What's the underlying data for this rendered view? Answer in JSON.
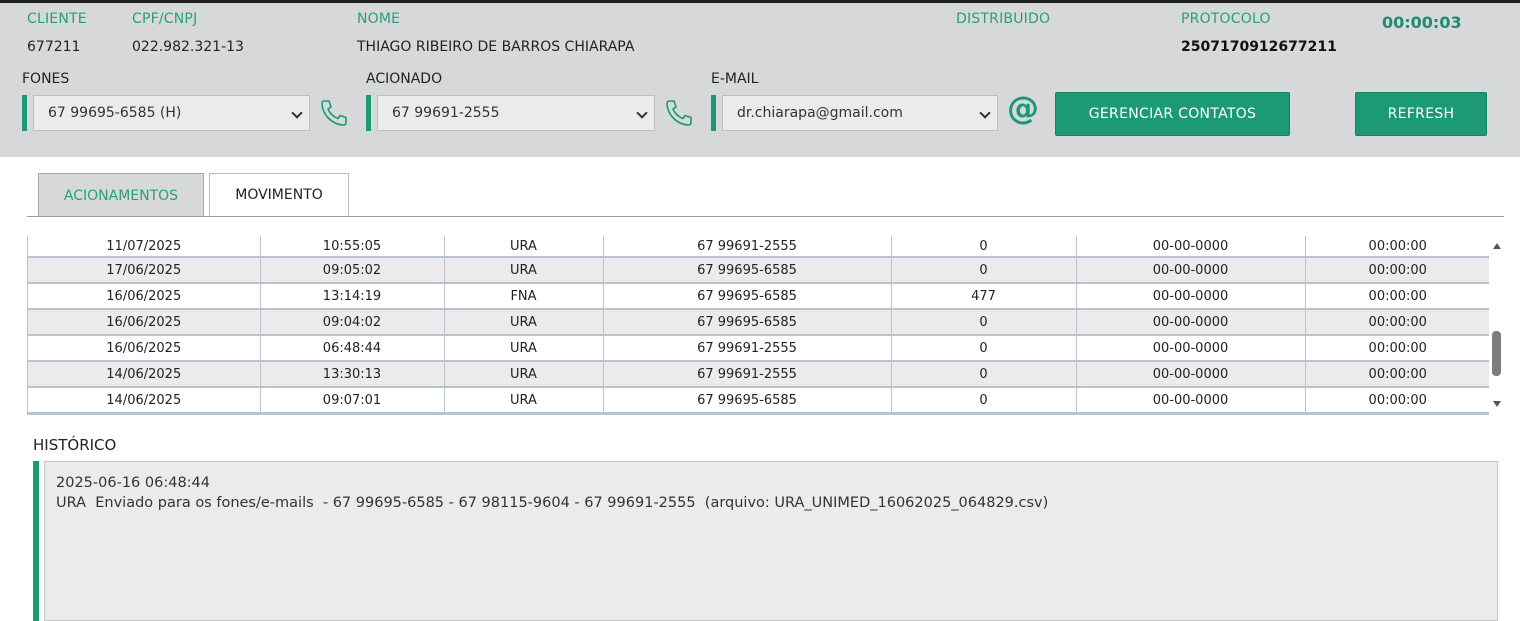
{
  "client": {
    "cliente_label": "CLIENTE",
    "cliente_value": "677211",
    "cpf_label": "CPF/CNPJ",
    "cpf_value": "022.982.321-13",
    "nome_label": "NOME",
    "nome_value": "THIAGO RIBEIRO DE BARROS CHIARAPA",
    "distribuido_label": "DISTRIBUIDO",
    "protocolo_label": "PROTOCOLO",
    "protocolo_value": "2507170912677211",
    "timer": "00:00:03"
  },
  "contacts": {
    "fones_label": "FONES",
    "fones_selected": "67 99695-6585 (H)",
    "acionado_label": "ACIONADO",
    "acionado_selected": "67 99691-2555",
    "email_label": "E-MAIL",
    "email_selected": "dr.chiarapa@gmail.com",
    "gerenciar_button": "GERENCIAR CONTATOS",
    "refresh_button": "REFRESH"
  },
  "tabs": [
    {
      "label": "ACIONAMENTOS",
      "active": true
    },
    {
      "label": "MOVIMENTO",
      "active": false
    }
  ],
  "rows": [
    [
      "11/07/2025",
      "10:55:05",
      "URA",
      "67 99691-2555",
      "0",
      "00-00-0000",
      "00:00:00"
    ],
    [
      "17/06/2025",
      "09:05:02",
      "URA",
      "67 99695-6585",
      "0",
      "00-00-0000",
      "00:00:00"
    ],
    [
      "16/06/2025",
      "13:14:19",
      "FNA",
      "67 99695-6585",
      "477",
      "00-00-0000",
      "00:00:00"
    ],
    [
      "16/06/2025",
      "09:04:02",
      "URA",
      "67 99695-6585",
      "0",
      "00-00-0000",
      "00:00:00"
    ],
    [
      "16/06/2025",
      "06:48:44",
      "URA",
      "67 99691-2555",
      "0",
      "00-00-0000",
      "00:00:00"
    ],
    [
      "14/06/2025",
      "13:30:13",
      "URA",
      "67 99691-2555",
      "0",
      "00-00-0000",
      "00:00:00"
    ],
    [
      "14/06/2025",
      "09:07:01",
      "URA",
      "67 99695-6585",
      "0",
      "00-00-0000",
      "00:00:00"
    ]
  ],
  "historico": {
    "label": "HISTÓRICO",
    "line1": "2025-06-16 06:48:44",
    "line2": "URA  Enviado para os fones/e-mails  - 67 99695-6585 - 67 98115-9604 - 67 99691-2555  (arquivo: URA_UNIMED_16062025_064829.csv)"
  },
  "colors": {
    "accent": "#1a9a72",
    "header_bg": "#d7d8d9",
    "label_green": "#27a07a"
  }
}
